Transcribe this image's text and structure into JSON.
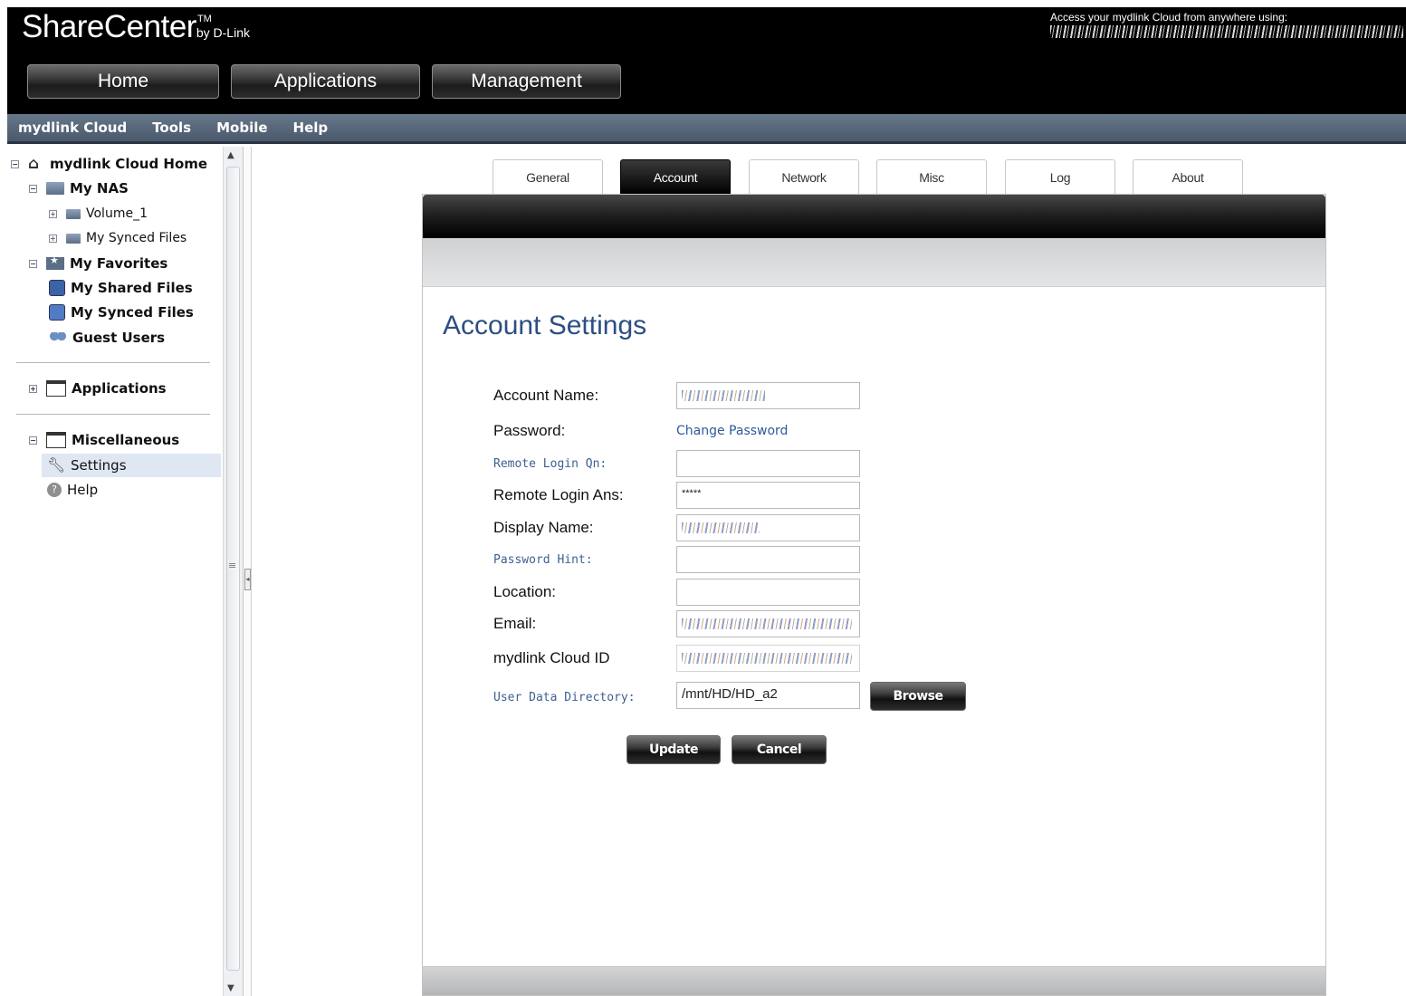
{
  "header": {
    "brand": "ShareCenter",
    "brand_tm": "TM",
    "brand_by": "by D-Link",
    "cloud_access_text": "Access your mydlink Cloud from anywhere using:"
  },
  "main_tabs": [
    {
      "label": "Home"
    },
    {
      "label": "Applications"
    },
    {
      "label": "Management"
    }
  ],
  "menubar": [
    {
      "label": "mydlink Cloud"
    },
    {
      "label": "Tools"
    },
    {
      "label": "Mobile"
    },
    {
      "label": "Help"
    }
  ],
  "sidebar": {
    "root": "mydlink Cloud Home",
    "my_nas": "My NAS",
    "volume_1": "Volume_1",
    "my_synced_files_sub": "My Synced Files",
    "my_favorites": "My Favorites",
    "my_shared_files": "My Shared Files",
    "my_synced_files": "My Synced Files",
    "guest_users": "Guest Users",
    "applications": "Applications",
    "miscellaneous": "Miscellaneous",
    "settings": "Settings",
    "help": "Help"
  },
  "sub_tabs": [
    {
      "label": "General"
    },
    {
      "label": "Account",
      "active": true
    },
    {
      "label": "Network"
    },
    {
      "label": "Misc"
    },
    {
      "label": "Log"
    },
    {
      "label": "About"
    }
  ],
  "account": {
    "title": "Account Settings",
    "labels": {
      "account_name": "Account Name:",
      "password": "Password:",
      "remote_login_qn": "Remote Login Qn:",
      "remote_login_ans": "Remote Login Ans:",
      "display_name": "Display Name:",
      "password_hint": "Password Hint:",
      "location": "Location:",
      "email": "Email:",
      "cloud_id": "mydlink Cloud ID",
      "user_data_dir": "User Data Directory:"
    },
    "change_password": "Change Password",
    "values": {
      "remote_login_qn": "",
      "remote_login_ans": "*****",
      "password_hint": "",
      "location": "",
      "user_data_dir": "/mnt/HD/HD_a2"
    },
    "buttons": {
      "browse": "Browse",
      "update": "Update",
      "cancel": "Cancel"
    }
  },
  "colors": {
    "header_bg": "#000000",
    "menubar_bg": "#5a6b7d",
    "title": "#2d4f82",
    "link": "#3e5f91"
  }
}
